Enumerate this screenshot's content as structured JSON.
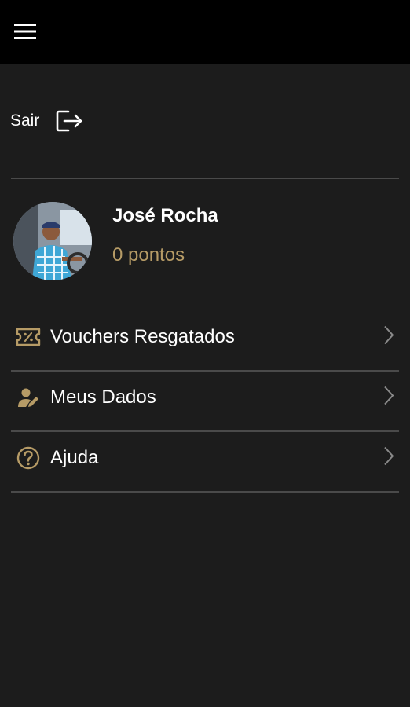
{
  "header": {
    "menu_icon": "hamburger-menu-icon"
  },
  "logout": {
    "label": "Sair",
    "icon": "logout-icon"
  },
  "profile": {
    "name": "José Rocha",
    "points": "0 pontos",
    "avatar": "profile-photo"
  },
  "menu": {
    "items": [
      {
        "label": "Vouchers Resgatados",
        "icon": "voucher-ticket-icon"
      },
      {
        "label": "Meus Dados",
        "icon": "user-edit-icon"
      },
      {
        "label": "Ajuda",
        "icon": "help-circle-icon"
      }
    ]
  },
  "colors": {
    "background": "#1c1c1c",
    "topbar": "#000000",
    "accent": "#b69b66",
    "divider": "#4a4a4a",
    "text": "#ffffff"
  }
}
